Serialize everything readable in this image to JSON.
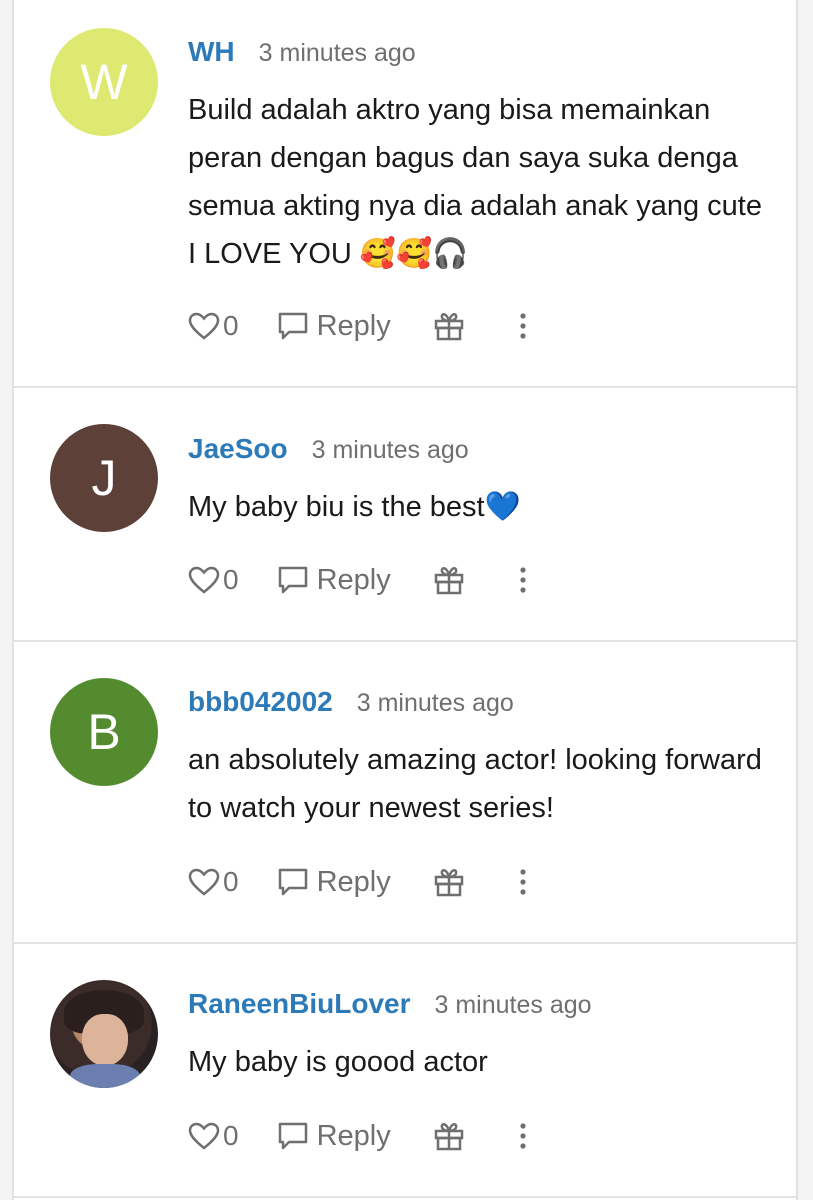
{
  "comments": [
    {
      "avatar_letter": "W",
      "avatar_color": "#dde970",
      "username": "WH",
      "time": "3 minutes ago",
      "text": "Build adalah aktro yang bisa memainkan peran dengan bagus dan saya suka denga semua akting nya dia adalah anak yang cute I LOVE YOU 🥰🥰🎧",
      "likes": "0",
      "reply_label": "Reply"
    },
    {
      "avatar_letter": "J",
      "avatar_color": "#5d4037",
      "username": "JaeSoo",
      "time": "3 minutes ago",
      "text": "My baby biu is the best💙",
      "likes": "0",
      "reply_label": "Reply"
    },
    {
      "avatar_letter": "B",
      "avatar_color": "#558b2f",
      "username": "bbb042002",
      "time": "3 minutes ago",
      "text": "an absolutely amazing actor! looking forward to watch your newest series!",
      "likes": "0",
      "reply_label": "Reply"
    },
    {
      "avatar_letter": "",
      "avatar_color": "",
      "username": "RaneenBiuLover",
      "time": "3 minutes ago",
      "text": "My baby is goood actor",
      "likes": "0",
      "reply_label": "Reply"
    }
  ],
  "icons": {
    "like": "heart-icon",
    "reply": "speech-bubble-icon",
    "gift": "gift-icon",
    "more": "more-vertical-icon"
  },
  "colors": {
    "username": "#2d7ab8",
    "meta_text": "#6f6f6f",
    "divider": "#e2e2e2"
  }
}
